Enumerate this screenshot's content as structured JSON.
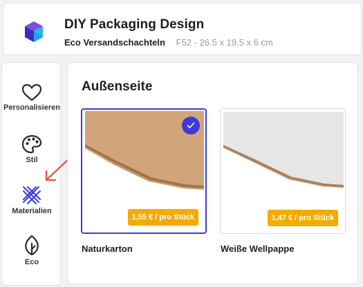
{
  "header": {
    "title": "DIY Packaging Design",
    "product_name": "Eco Versandschachteln",
    "product_spec": "F52 - 26.5 x 19.5 x 6 cm",
    "logo_icon": "cube-logo-icon"
  },
  "sidebar": {
    "items": [
      {
        "label": "Personalisieren",
        "icon": "heart-icon"
      },
      {
        "label": "Stil",
        "icon": "palette-icon"
      },
      {
        "label": "Materialien",
        "icon": "materials-icon",
        "active": true
      },
      {
        "label": "Eco",
        "icon": "leaf-icon"
      }
    ]
  },
  "main": {
    "section_title": "Außenseite",
    "materials": [
      {
        "name": "Naturkarton",
        "price": "1,55 € / pro Stück",
        "selected": true
      },
      {
        "name": "Weiße Wellpappe",
        "price": "1,47 € / pro Stück",
        "selected": false
      }
    ]
  },
  "colors": {
    "accent": "#3d3bd4",
    "price_badge": "#f4ab00",
    "arrow": "#e8544a"
  }
}
